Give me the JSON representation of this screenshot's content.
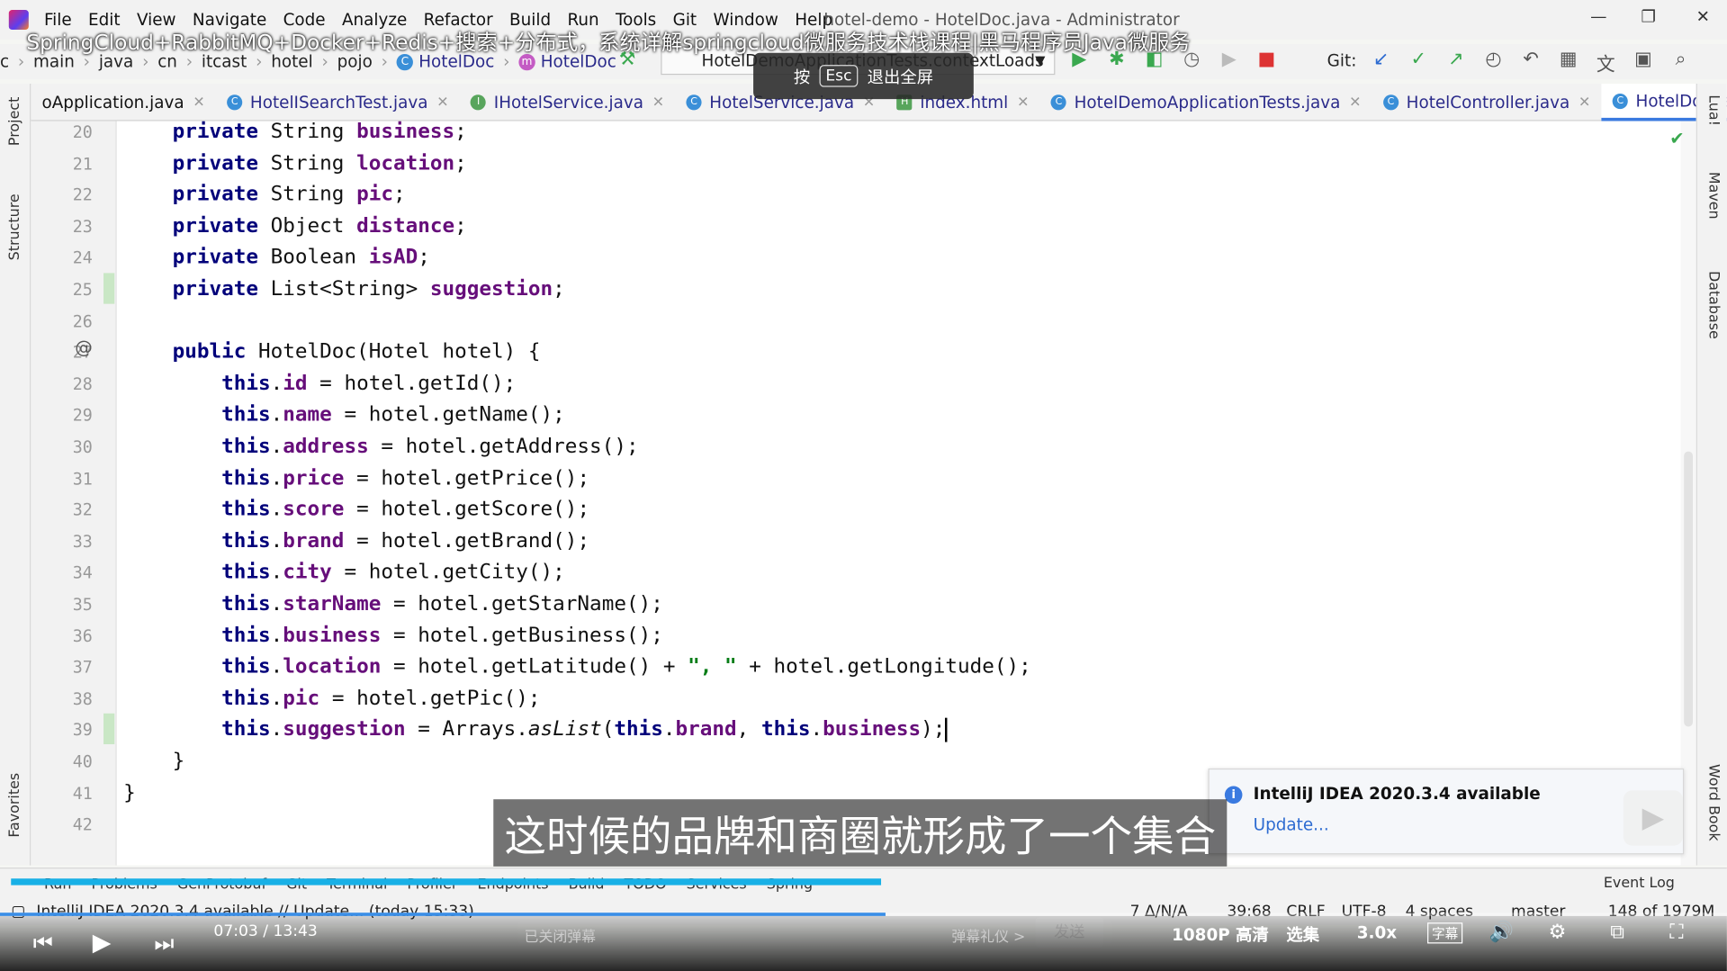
{
  "window": {
    "menu": [
      "File",
      "Edit",
      "View",
      "Navigate",
      "Code",
      "Analyze",
      "Refactor",
      "Build",
      "Run",
      "Tools",
      "Git",
      "Window",
      "Help"
    ],
    "title": "hotel-demo - HotelDoc.java - Administrator"
  },
  "video": {
    "title": "SpringCloud+RabbitMQ+Docker+Redis+搜索+分布式，系统详解springcloud微服务技术栈课程|黑马程序员Java微服务",
    "esc_hint_prefix": "按",
    "esc_key": "Esc",
    "esc_hint_suffix": "退出全屏",
    "subtitle": "这时候的品牌和商圈就形成了一个集合",
    "time": "07:03 / 13:43",
    "progress": 0.513,
    "danmu_closed": "已关闭弹幕",
    "danmu_etiquette": "弹幕礼仪 >",
    "send": "发送",
    "quality": "1080P 高清",
    "episodes": "选集",
    "speed": "3.0x",
    "caption_btn": "字幕"
  },
  "breadcrumb": [
    "c",
    "main",
    "java",
    "cn",
    "itcast",
    "hotel",
    "pojo",
    "HotelDoc",
    "HotelDoc"
  ],
  "run_config": "HotelDemoApplicationTests.contextLoads",
  "git_label": "Git:",
  "tabs": [
    {
      "label": "oApplication.java",
      "icon": "",
      "color": ""
    },
    {
      "label": "HotelISearchTest.java",
      "icon": "C",
      "color": "#3a8fd8"
    },
    {
      "label": "IHotelService.java",
      "icon": "I",
      "color": "#58a55c"
    },
    {
      "label": "HotelService.java",
      "icon": "C",
      "color": "#3a8fd8"
    },
    {
      "label": "index.html",
      "icon": "H",
      "color": "#58a55c"
    },
    {
      "label": "HotelDemoApplicationTests.java",
      "icon": "C",
      "color": "#3a8fd8"
    },
    {
      "label": "HotelController.java",
      "icon": "C",
      "color": "#3a8fd8"
    },
    {
      "label": "HotelDoc.java",
      "icon": "C",
      "color": "#3a8fd8"
    }
  ],
  "left_tools": [
    "Project",
    "Structure",
    "Favorites"
  ],
  "right_tools": [
    "Lua!",
    "Maven",
    "Database",
    "Word Book"
  ],
  "code": {
    "line_numbers": [
      "20",
      "21",
      "22",
      "23",
      "24",
      "25",
      "26",
      "27",
      "28",
      "29",
      "30",
      "31",
      "32",
      "33",
      "34",
      "35",
      "36",
      "37",
      "38",
      "39",
      "40",
      "41",
      "42"
    ],
    "lines": [
      [
        [
          "    ",
          ""
        ],
        [
          "private ",
          "kw"
        ],
        [
          "String ",
          ""
        ],
        [
          "business",
          "fld"
        ],
        [
          ";",
          ""
        ]
      ],
      [
        [
          "    ",
          ""
        ],
        [
          "private ",
          "kw"
        ],
        [
          "String ",
          ""
        ],
        [
          "location",
          "fld"
        ],
        [
          ";",
          ""
        ]
      ],
      [
        [
          "    ",
          ""
        ],
        [
          "private ",
          "kw"
        ],
        [
          "String ",
          ""
        ],
        [
          "pic",
          "fld"
        ],
        [
          ";",
          ""
        ]
      ],
      [
        [
          "    ",
          ""
        ],
        [
          "private ",
          "kw"
        ],
        [
          "Object ",
          ""
        ],
        [
          "distance",
          "fld"
        ],
        [
          ";",
          ""
        ]
      ],
      [
        [
          "    ",
          ""
        ],
        [
          "private ",
          "kw"
        ],
        [
          "Boolean ",
          ""
        ],
        [
          "isAD",
          "fld"
        ],
        [
          ";",
          ""
        ]
      ],
      [
        [
          "    ",
          ""
        ],
        [
          "private ",
          "kw"
        ],
        [
          "List<String> ",
          ""
        ],
        [
          "suggestion",
          "fld"
        ],
        [
          ";",
          ""
        ]
      ],
      [],
      [
        [
          "    ",
          ""
        ],
        [
          "public ",
          "kw"
        ],
        [
          "HotelDoc(Hotel hotel) {",
          ""
        ]
      ],
      [
        [
          "        ",
          ""
        ],
        [
          "this",
          "kw"
        ],
        [
          ".",
          ""
        ],
        [
          "id",
          "fld"
        ],
        [
          " = hotel.getId();",
          ""
        ]
      ],
      [
        [
          "        ",
          ""
        ],
        [
          "this",
          "kw"
        ],
        [
          ".",
          ""
        ],
        [
          "name",
          "fld"
        ],
        [
          " = hotel.getName();",
          ""
        ]
      ],
      [
        [
          "        ",
          ""
        ],
        [
          "this",
          "kw"
        ],
        [
          ".",
          ""
        ],
        [
          "address",
          "fld"
        ],
        [
          " = hotel.getAddress();",
          ""
        ]
      ],
      [
        [
          "        ",
          ""
        ],
        [
          "this",
          "kw"
        ],
        [
          ".",
          ""
        ],
        [
          "price",
          "fld"
        ],
        [
          " = hotel.getPrice();",
          ""
        ]
      ],
      [
        [
          "        ",
          ""
        ],
        [
          "this",
          "kw"
        ],
        [
          ".",
          ""
        ],
        [
          "score",
          "fld"
        ],
        [
          " = hotel.getScore();",
          ""
        ]
      ],
      [
        [
          "        ",
          ""
        ],
        [
          "this",
          "kw"
        ],
        [
          ".",
          ""
        ],
        [
          "brand",
          "fld"
        ],
        [
          " = hotel.getBrand();",
          ""
        ]
      ],
      [
        [
          "        ",
          ""
        ],
        [
          "this",
          "kw"
        ],
        [
          ".",
          ""
        ],
        [
          "city",
          "fld"
        ],
        [
          " = hotel.getCity();",
          ""
        ]
      ],
      [
        [
          "        ",
          ""
        ],
        [
          "this",
          "kw"
        ],
        [
          ".",
          ""
        ],
        [
          "starName",
          "fld"
        ],
        [
          " = hotel.getStarName();",
          ""
        ]
      ],
      [
        [
          "        ",
          ""
        ],
        [
          "this",
          "kw"
        ],
        [
          ".",
          ""
        ],
        [
          "business",
          "fld"
        ],
        [
          " = hotel.getBusiness();",
          ""
        ]
      ],
      [
        [
          "        ",
          ""
        ],
        [
          "this",
          "kw"
        ],
        [
          ".",
          ""
        ],
        [
          "location",
          "fld"
        ],
        [
          " = hotel.getLatitude() + ",
          ""
        ],
        [
          "\", \"",
          "str"
        ],
        [
          " + hotel.getLongitude();",
          ""
        ]
      ],
      [
        [
          "        ",
          ""
        ],
        [
          "this",
          "kw"
        ],
        [
          ".",
          ""
        ],
        [
          "pic",
          "fld"
        ],
        [
          " = hotel.getPic();",
          ""
        ]
      ],
      [
        [
          "        ",
          ""
        ],
        [
          "this",
          "kw"
        ],
        [
          ".",
          ""
        ],
        [
          "suggestion",
          "fld"
        ],
        [
          " = Arrays.",
          ""
        ],
        [
          "asList",
          "it"
        ],
        [
          "(",
          ""
        ],
        [
          "this",
          "kw"
        ],
        [
          ".",
          ""
        ],
        [
          "brand",
          "fld"
        ],
        [
          ", ",
          ""
        ],
        [
          "this",
          "kw"
        ],
        [
          ".",
          ""
        ],
        [
          "business",
          "fld"
        ],
        [
          ");",
          ""
        ]
      ],
      [
        [
          "    }",
          ""
        ]
      ],
      [
        [
          "}",
          ""
        ]
      ],
      []
    ]
  },
  "notification": {
    "title": "IntelliJ IDEA 2020.3.4 available",
    "link": "Update..."
  },
  "bottom_tools": [
    "Run",
    "Problems",
    "GenProtobuf",
    "Git",
    "Terminal",
    "Profiler",
    "Endpoints",
    "Build",
    "TODO",
    "Services",
    "Spring"
  ],
  "event_log": "Event Log",
  "status": {
    "message": "IntelliJ IDEA 2020.3.4 available // Update... (today 15:33)",
    "inspections": "7 Δ/N/A",
    "position": "39:68",
    "line_sep": "CRLF",
    "encoding": "UTF-8",
    "indent": "4 spaces",
    "branch": "master",
    "memory": "148 of 1979M"
  }
}
